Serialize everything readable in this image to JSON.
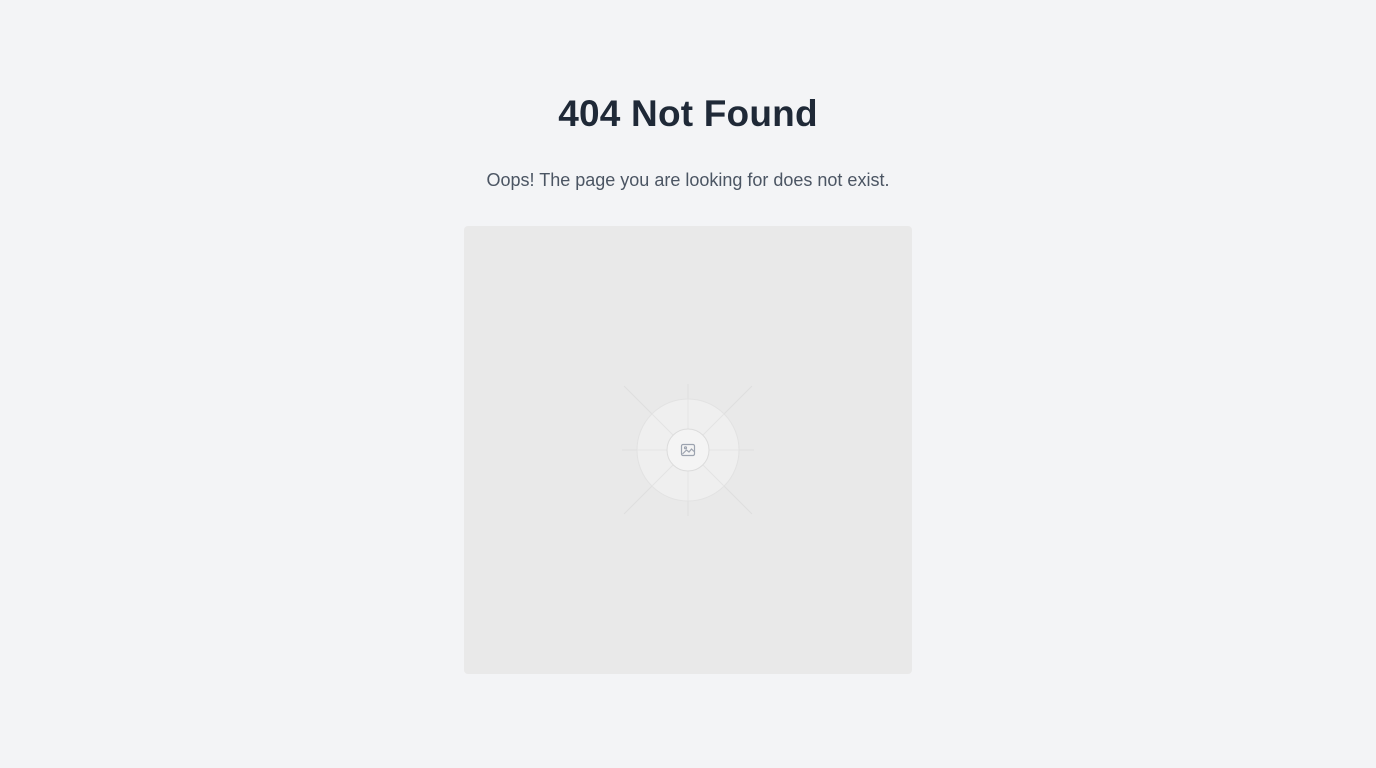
{
  "error": {
    "title": "404 Not Found",
    "message": "Oops! The page you are looking for does not exist."
  },
  "image_placeholder": {
    "icon": "image-icon",
    "background_color": "#e9e9e9"
  },
  "colors": {
    "page_background": "#f3f4f6",
    "title": "#1f2937",
    "message": "#4b5563"
  }
}
